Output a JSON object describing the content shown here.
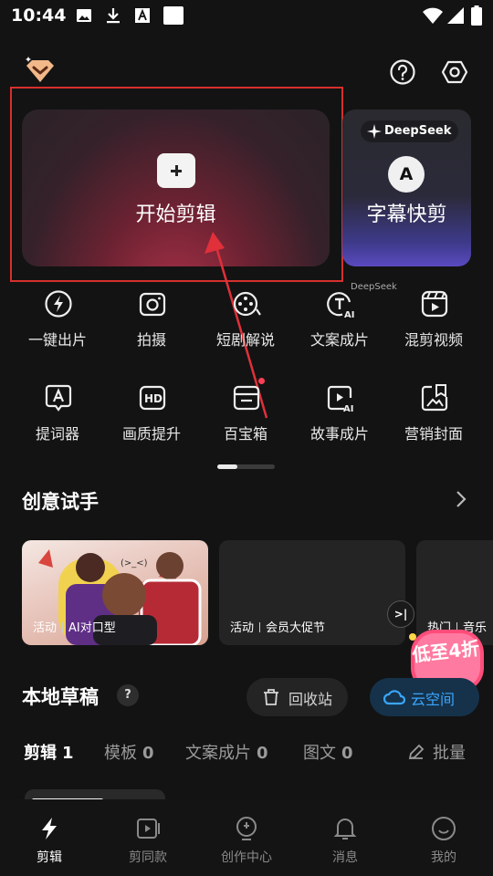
{
  "status_bar": {
    "time": "10:44"
  },
  "main_card": {
    "label": "开始剪辑"
  },
  "side_card": {
    "badge": "DeepSeek",
    "icon_letter": "A",
    "label": "字幕快剪",
    "sub": "DeepSeek"
  },
  "tools": [
    {
      "label": "一键出片",
      "icon": "lightning-circle-icon"
    },
    {
      "label": "拍摄",
      "icon": "camera-icon"
    },
    {
      "label": "短剧解说",
      "icon": "film-reel-icon"
    },
    {
      "label": "文案成片",
      "icon": "text-ai-icon"
    },
    {
      "label": "混剪视频",
      "icon": "mix-video-icon"
    },
    {
      "label": "提词器",
      "icon": "teleprompter-icon"
    },
    {
      "label": "画质提升",
      "icon": "hd-icon"
    },
    {
      "label": "百宝箱",
      "icon": "toolbox-icon"
    },
    {
      "label": "故事成片",
      "icon": "story-ai-icon"
    },
    {
      "label": "营销封面",
      "icon": "cover-icon"
    }
  ],
  "creative": {
    "title": "创意试手",
    "cards": [
      {
        "tag": "活动",
        "label": "AI对口型"
      },
      {
        "tag": "活动",
        "label": "会员大促节"
      },
      {
        "tag": "热门",
        "label": "音乐"
      }
    ],
    "promo": "低至4折"
  },
  "drafts": {
    "title": "本地草稿",
    "help": "?",
    "recycle": "回收站",
    "cloud": "云空间",
    "tabs": [
      {
        "label": "剪辑",
        "count": "1"
      },
      {
        "label": "模板",
        "count": "0"
      },
      {
        "label": "文案成片",
        "count": "0"
      },
      {
        "label": "图文",
        "count": "0"
      }
    ],
    "batch": "批量"
  },
  "nav": [
    {
      "label": "剪辑"
    },
    {
      "label": "剪同款"
    },
    {
      "label": "创作中心"
    },
    {
      "label": "消息"
    },
    {
      "label": "我的"
    }
  ],
  "colors": {
    "accent_red": "#d6302d",
    "link_blue": "#3aa6ff",
    "badge_red": "#ff3f56"
  }
}
